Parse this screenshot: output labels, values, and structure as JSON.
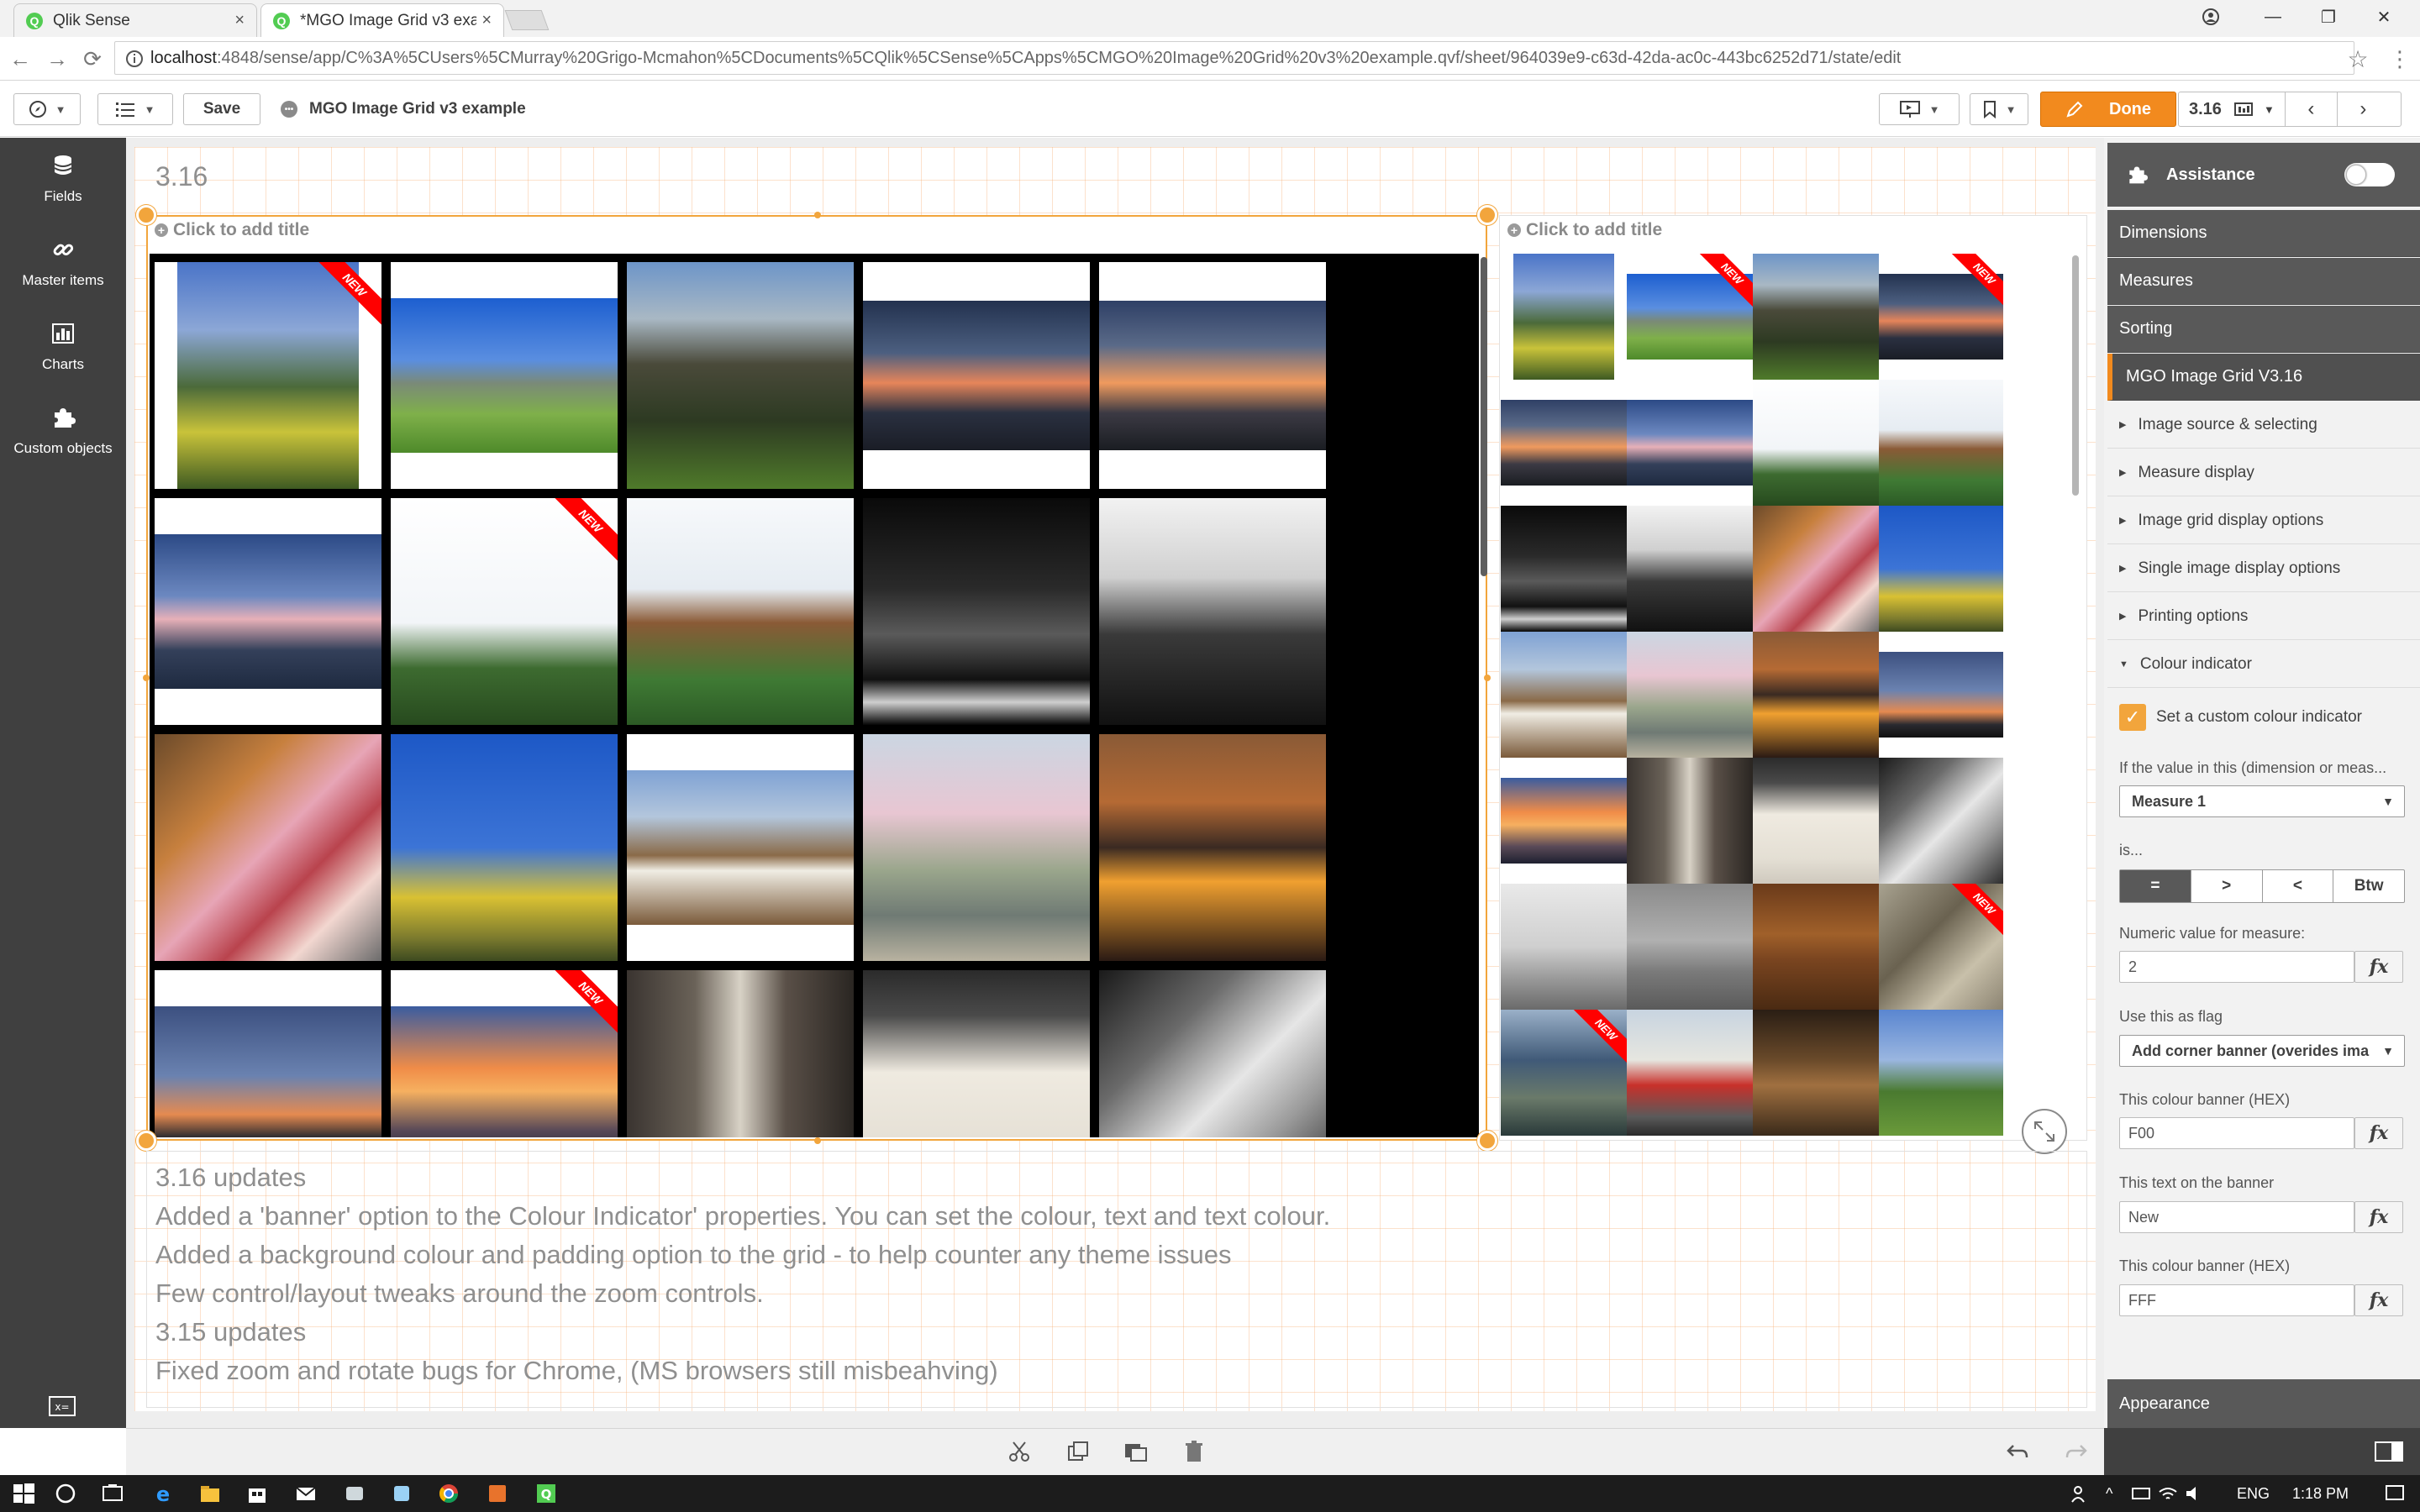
{
  "browser": {
    "tabs": [
      {
        "title": "Qlik Sense",
        "active": false
      },
      {
        "title": "*MGO Image Grid v3 exa",
        "active": true
      }
    ],
    "url_host": "localhost",
    "url_path": ":4848/sense/app/C%3A%5CUsers%5CMurray%20Grigo-Mcmahon%5CDocuments%5CQlik%5CSense%5CApps%5CMGO%20Image%20Grid%20v3%20example.qvf/sheet/964039e9-c63d-42da-ac0c-443bc6252d71/state/edit"
  },
  "toolbar": {
    "save_label": "Save",
    "app_title": "MGO Image Grid v3 example",
    "done_label": "Done",
    "sheet_number": "3.16"
  },
  "left_panel": {
    "items": [
      {
        "label": "Fields",
        "icon": "database-icon"
      },
      {
        "label": "Master items",
        "icon": "link-icon"
      },
      {
        "label": "Charts",
        "icon": "bar-chart-icon"
      },
      {
        "label": "Custom objects",
        "icon": "puzzle-icon"
      }
    ]
  },
  "sheet": {
    "title": "3.16",
    "left_object_title": "Click to add title",
    "right_object_title": "Click to add title",
    "banner_text": "New",
    "banner_color": "#ff0000",
    "banner_text_color": "#ffffff",
    "text_lines": [
      "3.16 updates",
      "Added a 'banner' option to the Colour Indicator' properties. You can set the colour, text and text colour.",
      "Added a background colour and padding option to the grid - to help counter any theme issues",
      "Few control/layout tweaks around the zoom controls.",
      "3.15 updates",
      "Fixed zoom and rotate bugs for Chrome, (MS browsers still misbeahving)"
    ]
  },
  "grid_left": {
    "tiles": [
      {
        "scene": "trees-yellow-flowers",
        "fit": "portrait",
        "banner": true
      },
      {
        "scene": "hillside-house-blue-sky",
        "fit": "landscape",
        "banner": false
      },
      {
        "scene": "hills-dark-green",
        "fit": "full",
        "banner": false
      },
      {
        "scene": "sunset-city-spire",
        "fit": "landscape-wide",
        "banner": false
      },
      {
        "scene": "sunset-clouds-city",
        "fit": "landscape-wide",
        "banner": false
      },
      {
        "scene": "dusk-pink-clouds",
        "fit": "landscape",
        "banner": false
      },
      {
        "scene": "hawk-flying-tree",
        "fit": "full",
        "banner": true
      },
      {
        "scene": "hawk-perched-white-sky",
        "fit": "full",
        "banner": false
      },
      {
        "scene": "bw-houses-night",
        "fit": "full",
        "banner": false
      },
      {
        "scene": "bw-hawk-tree",
        "fit": "full",
        "banner": false
      },
      {
        "scene": "graffiti-roof",
        "fit": "full",
        "banner": false
      },
      {
        "scene": "yellow-bush-blue-sky",
        "fit": "full",
        "banner": false
      },
      {
        "scene": "terrier-dirt-city",
        "fit": "landscape",
        "banner": false
      },
      {
        "scene": "blossom-tree-street",
        "fit": "full",
        "banner": false
      },
      {
        "scene": "skyscraper-gold-lights",
        "fit": "full",
        "banner": false
      },
      {
        "scene": "rooftop-sunset-silhouette",
        "fit": "landscape",
        "banner": false
      },
      {
        "scene": "orange-sunset-sky",
        "fit": "landscape",
        "banner": true
      },
      {
        "scene": "terrier-doorway",
        "fit": "full",
        "banner": false
      },
      {
        "scene": "pizza-box",
        "fit": "full",
        "banner": false
      },
      {
        "scene": "bw-terrier-closeup",
        "fit": "full",
        "banner": false
      }
    ]
  },
  "grid_right": {
    "tiles": [
      {
        "scene": "trees-yellow-flowers",
        "fit": "portrait",
        "banner": false
      },
      {
        "scene": "hillside-house-blue-sky",
        "fit": "landscape",
        "banner": true
      },
      {
        "scene": "hills-dark-green",
        "fit": "full",
        "banner": false
      },
      {
        "scene": "sunset-city-spire",
        "fit": "landscape",
        "banner": true
      },
      {
        "scene": "sunset-clouds-city",
        "fit": "landscape",
        "banner": false
      },
      {
        "scene": "dusk-pink-clouds",
        "fit": "landscape",
        "banner": false
      },
      {
        "scene": "hawk-flying-tree",
        "fit": "full",
        "banner": false
      },
      {
        "scene": "hawk-perched-white-sky",
        "fit": "full",
        "banner": false
      },
      {
        "scene": "bw-houses-night",
        "fit": "full",
        "banner": false
      },
      {
        "scene": "bw-hawk-tree",
        "fit": "full",
        "banner": false
      },
      {
        "scene": "graffiti-roof",
        "fit": "full",
        "banner": false
      },
      {
        "scene": "yellow-bush-blue-sky",
        "fit": "full",
        "banner": false
      },
      {
        "scene": "terrier-dirt-city",
        "fit": "full",
        "banner": false
      },
      {
        "scene": "blossom-tree-street",
        "fit": "full",
        "banner": false
      },
      {
        "scene": "skyscraper-gold-lights",
        "fit": "full",
        "banner": false
      },
      {
        "scene": "rooftop-sunset-silhouette",
        "fit": "landscape",
        "banner": false
      },
      {
        "scene": "orange-sunset-sky",
        "fit": "landscape",
        "banner": false
      },
      {
        "scene": "terrier-doorway",
        "fit": "full",
        "banner": false
      },
      {
        "scene": "pizza-box",
        "fit": "full",
        "banner": false
      },
      {
        "scene": "bw-terrier-closeup",
        "fit": "full",
        "banner": false
      },
      {
        "scene": "bw-dog-floor",
        "fit": "full",
        "banner": false
      },
      {
        "scene": "bw-whitney-sign",
        "fit": "full",
        "banner": false
      },
      {
        "scene": "wooden-drawer",
        "fit": "full",
        "banner": false
      },
      {
        "scene": "cables-wall",
        "fit": "full",
        "banner": true
      },
      {
        "scene": "reflection-window",
        "fit": "full",
        "banner": true
      },
      {
        "scene": "red-vintage-car",
        "fit": "full",
        "banner": false
      },
      {
        "scene": "wooden-interior",
        "fit": "full",
        "banner": false
      },
      {
        "scene": "park-green-sky",
        "fit": "full",
        "banner": false
      }
    ]
  },
  "property_panel": {
    "assistance_label": "Assistance",
    "sections": [
      "Dimensions",
      "Measures",
      "Sorting"
    ],
    "active_section": "MGO Image Grid V3.16",
    "subsections": [
      "Image source & selecting",
      "Measure display",
      "Image grid display options",
      "Single image display options",
      "Printing options",
      "Colour indicator"
    ],
    "custom_colour_label": "Set a custom colour indicator",
    "if_value_label": "If the value in this (dimension or meas...",
    "measure_select": "Measure 1",
    "is_label": "is...",
    "operators": [
      "=",
      ">",
      "<",
      "Btw"
    ],
    "numeric_label": "Numeric value for measure:",
    "numeric_value": "2",
    "flag_label": "Use this as flag",
    "flag_select": "Add corner banner (overides ima",
    "banner_colour_label": "This colour banner (HEX)",
    "banner_colour_value": "F00",
    "banner_text_label": "This text on the banner",
    "banner_text_value": "New",
    "text_colour_label": "This colour banner (HEX)",
    "text_colour_value": "FFF",
    "appearance_label": "Appearance",
    "fx_label": "fx"
  },
  "taskbar": {
    "lang": "ENG",
    "time": "1:18 PM"
  },
  "colors": {
    "accent_orange": "#f28a1e",
    "panel_dark": "#595959",
    "left_panel": "#404040"
  }
}
